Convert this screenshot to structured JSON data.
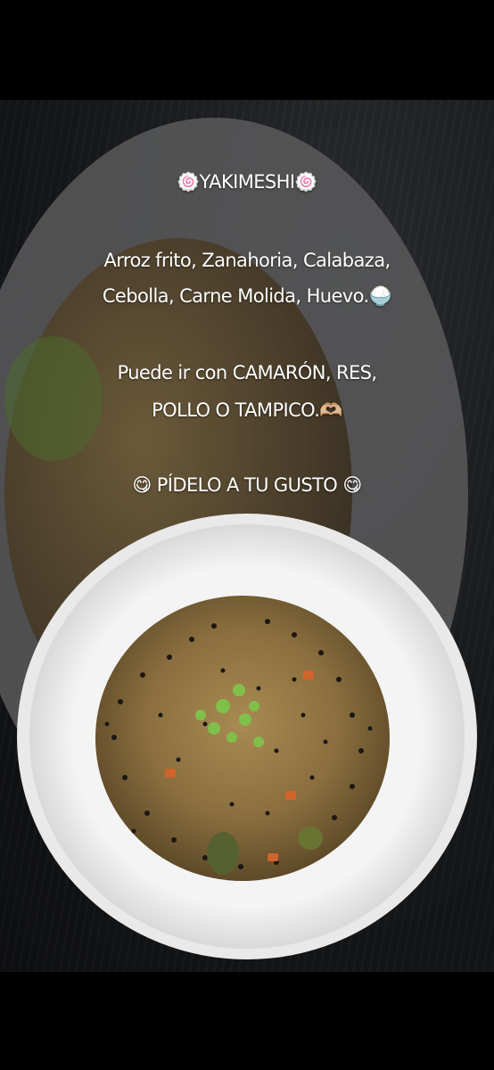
{
  "story": {
    "title": "🍥YAKIMESHI🍥",
    "ingredients_line1": "Arroz frito, Zanahoria, Calabaza,",
    "ingredients_line2": "Cebolla, Carne Molida, Huevo.🍚",
    "options_line1": "Puede ir con CAMARÓN, RES,",
    "options_line2": "POLLO O TAMPICO.🫶🏼",
    "cta": "😋 PÍDELO A TU GUSTO 😋"
  }
}
